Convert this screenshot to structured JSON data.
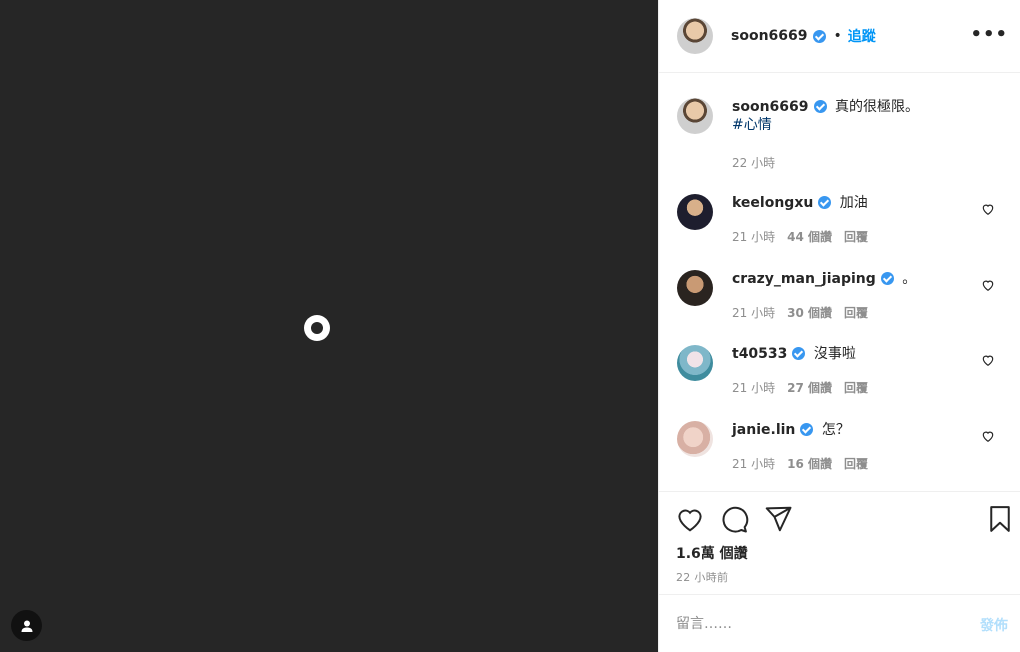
{
  "header": {
    "username": "soon6669",
    "separator": "•",
    "follow_label": "追蹤",
    "more_label": "•••"
  },
  "caption": {
    "username": "soon6669",
    "text": "真的很極限。",
    "hashtag": "#心情",
    "time": "22 小時"
  },
  "comments": [
    {
      "username": "keelongxu",
      "text": "加油",
      "time": "21 小時",
      "likes": "44 個讚",
      "reply": "回覆"
    },
    {
      "username": "crazy_man_jiaping",
      "text": "。",
      "time": "21 小時",
      "likes": "30 個讚",
      "reply": "回覆"
    },
    {
      "username": "t40533",
      "text": "沒事啦",
      "time": "21 小時",
      "likes": "27 個讚",
      "reply": "回覆"
    },
    {
      "username": "janie.lin",
      "text": "怎？",
      "time": "21 小時",
      "likes": "16 個讚",
      "reply": "回覆"
    }
  ],
  "actions": {
    "likes_count": "1.6萬 個讚",
    "posted_time": "22 小時前"
  },
  "add_comment": {
    "placeholder": "留言……",
    "post_label": "發佈"
  },
  "colors": {
    "media_bg": "#262626",
    "accent": "#0095f6",
    "verified": "#3897f0",
    "post_disabled": "#b2dffc"
  }
}
